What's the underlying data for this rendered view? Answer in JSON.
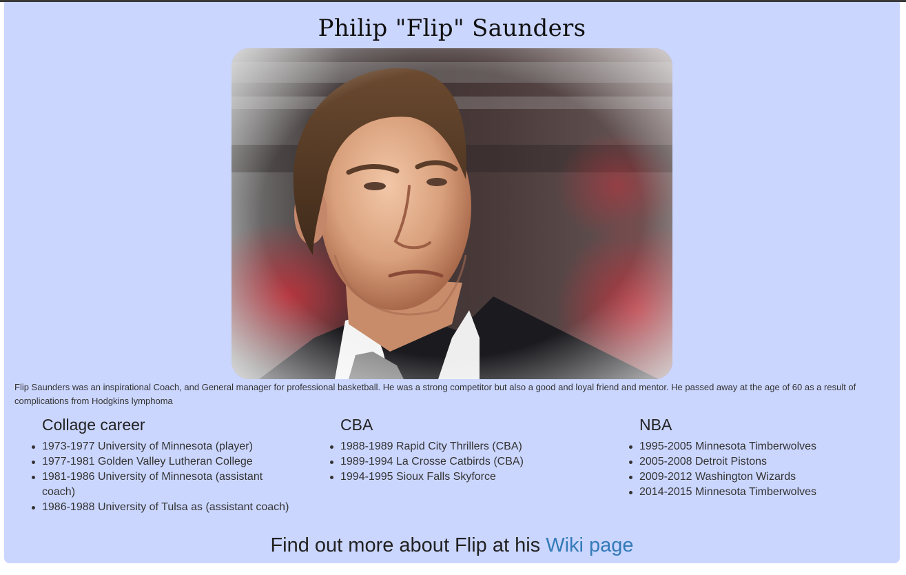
{
  "page": {
    "title": "Philip \"Flip\" Saunders",
    "bio": "Flip Saunders was an inspirational Coach, and General manager for professional basketball. He was a strong competitor but also a good and loyal friend and mentor. He passed away at the age of 60 as a result of complications from Hodgkins lymphoma",
    "background_color": "#cbd6ff"
  },
  "photo": {
    "subject": "portrait-of-flip-saunders"
  },
  "career": {
    "collage": {
      "heading": "Collage career",
      "items": [
        "1973-1977 University of Minnesota (player)",
        "1977-1981 Golden Valley Lutheran College",
        "1981-1986 University of Minnesota (assistant coach)",
        "1986-1988 University of Tulsa as (assistant coach)"
      ]
    },
    "cba": {
      "heading": "CBA",
      "items": [
        "1988-1989 Rapid City Thrillers (CBA)",
        "1989-1994 La Crosse Catbirds (CBA)",
        "1994-1995 Sioux Falls Skyforce"
      ]
    },
    "nba": {
      "heading": "NBA",
      "items": [
        "1995-2005 Minnesota Timberwolves",
        "2005-2008 Detroit Pistons",
        "2009-2012 Washington Wizards",
        "2014-2015 Minnesota Timberwolves"
      ]
    }
  },
  "footer": {
    "more_text": "Find out more about Flip at his ",
    "link_label": "Wiki page",
    "link_color": "#337ab7"
  }
}
